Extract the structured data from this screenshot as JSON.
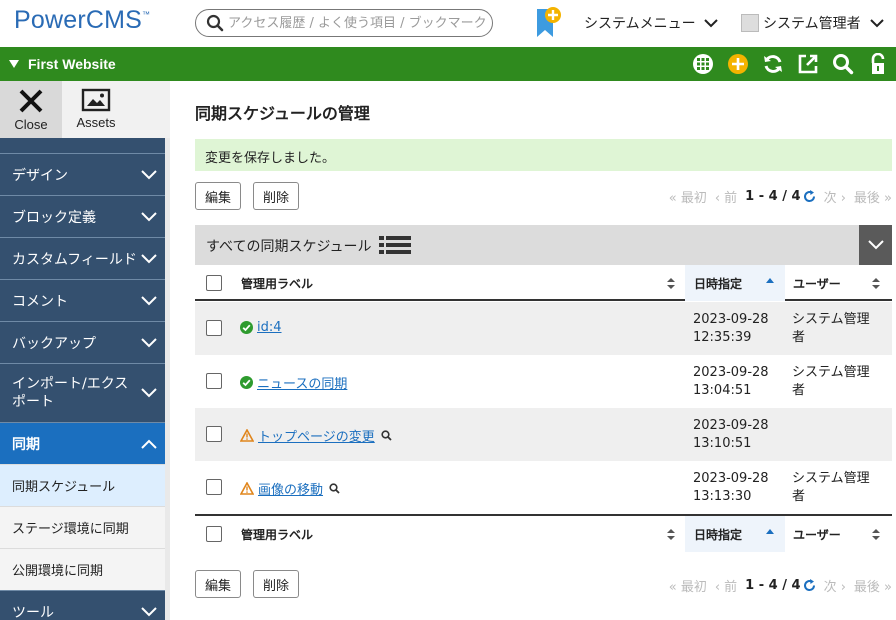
{
  "header": {
    "logo": "PowerCMS",
    "logo_tm": "™",
    "search_placeholder": "アクセス履歴 / よく使う項目 / ブックマーク",
    "system_menu": "システムメニュー",
    "user_menu": "システム管理者"
  },
  "site_bar": {
    "site_name": "First Website",
    "icons": [
      "grid-icon",
      "add-circle-icon",
      "refresh-icon",
      "external-link-icon",
      "search-icon",
      "unlock-icon"
    ]
  },
  "sidebar": {
    "tabs": [
      {
        "label": "Close",
        "icon": "close-icon"
      },
      {
        "label": "Assets",
        "icon": "image-icon"
      }
    ],
    "items": [
      {
        "label": "デザイン"
      },
      {
        "label": "ブロック定義"
      },
      {
        "label": "カスタムフィールド"
      },
      {
        "label": "コメント"
      },
      {
        "label": "バックアップ"
      },
      {
        "label": "インポート/エクスポート"
      },
      {
        "label": "同期"
      },
      {
        "label": "ツール"
      }
    ],
    "sub_items": [
      {
        "label": "同期スケジュール"
      },
      {
        "label": "ステージ環境に同期"
      },
      {
        "label": "公開環境に同期"
      }
    ]
  },
  "main": {
    "title": "同期スケジュールの管理",
    "notice": "変更を保存しました。",
    "edit_button": "編集",
    "delete_button": "削除",
    "pager": {
      "first": "« 最初",
      "prev": "‹ 前",
      "range": "1 - 4 / 4",
      "next": "次 ›",
      "last": "最後 »"
    },
    "list_title": "すべての同期スケジュール",
    "columns": {
      "label": "管理用ラベル",
      "date": "日時指定",
      "user": "ユーザー"
    },
    "rows": [
      {
        "status": "ok",
        "label": "id:4",
        "date1": "2023-09-28",
        "date2": "12:35:39",
        "user1": "システム管理",
        "user2": "者",
        "preview": false
      },
      {
        "status": "ok",
        "label": "ニュースの同期",
        "date1": "2023-09-28",
        "date2": "13:04:51",
        "user1": "システム管理",
        "user2": "者",
        "preview": false
      },
      {
        "status": "warn",
        "label": "トップページの変更",
        "date1": "2023-09-28",
        "date2": "13:10:51",
        "user1": "",
        "user2": "",
        "preview": true
      },
      {
        "status": "warn",
        "label": "画像の移動",
        "date1": "2023-09-28",
        "date2": "13:13:30",
        "user1": "システム管理",
        "user2": "者",
        "preview": true
      }
    ]
  },
  "colors": {
    "brand_blue": "#2a6bb5",
    "site_bar_green": "#2f8a1e",
    "sidebar_navy": "#34506f",
    "active_blue": "#1b6fbf",
    "notice_green": "#dff5d5"
  }
}
